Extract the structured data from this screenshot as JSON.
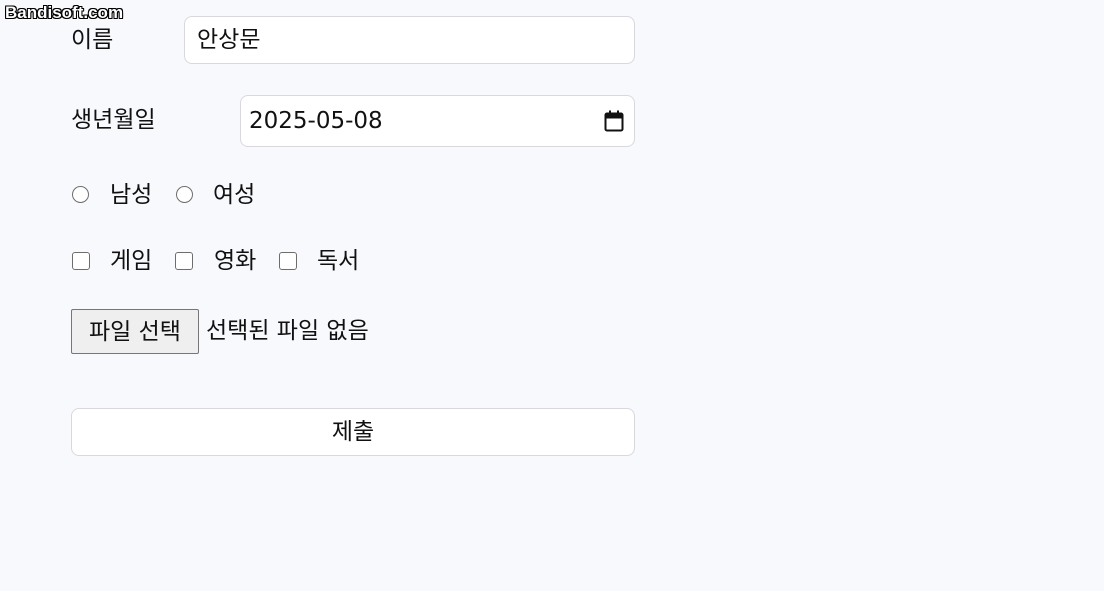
{
  "watermark": "Bandisoft.com",
  "form": {
    "name_label": "이름",
    "name_value": "안상문",
    "birth_label": "생년월일",
    "birth_value": "2025-05-08",
    "gender_options": [
      "남성",
      "여성"
    ],
    "hobby_options": [
      "게임",
      "영화",
      "독서"
    ],
    "file_button_label": "파일 선택",
    "file_status": "선택된 파일 없음",
    "submit_label": "제출"
  },
  "icons": {
    "calendar": "calendar-icon"
  }
}
